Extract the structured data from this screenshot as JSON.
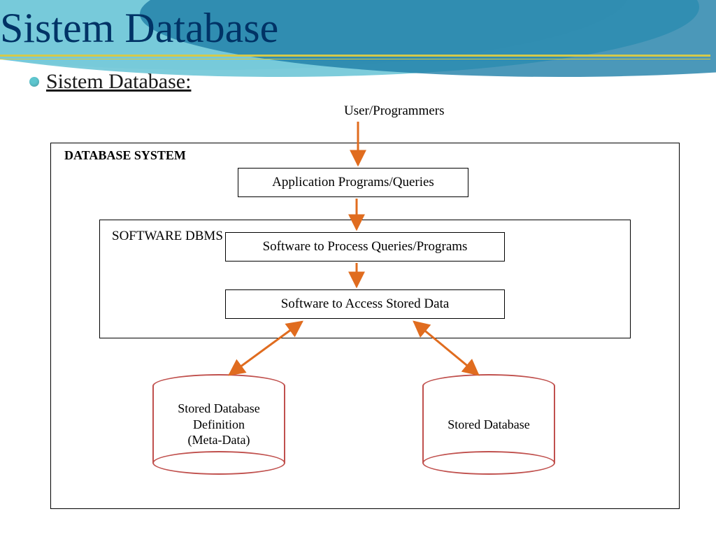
{
  "title": "Sistem Database",
  "heading": "Sistem Database:",
  "diagram": {
    "top_label": "User/Programmers",
    "outer_label": "DATABASE SYSTEM",
    "inner_label": "SOFTWARE DBMS",
    "box_app": "Application Programs/Queries",
    "box_process": "Software to Process Queries/Programs",
    "box_access": "Software to Access Stored Data",
    "cyl_meta": "Stored Database Definition\n(Meta-Data)",
    "cyl_db": "Stored Database"
  },
  "colors": {
    "arrow": "#e06c1f",
    "cylinder": "#c0504d",
    "bullet": "#5ec6cf",
    "underline": "#d4c94a",
    "title": "#003366"
  }
}
